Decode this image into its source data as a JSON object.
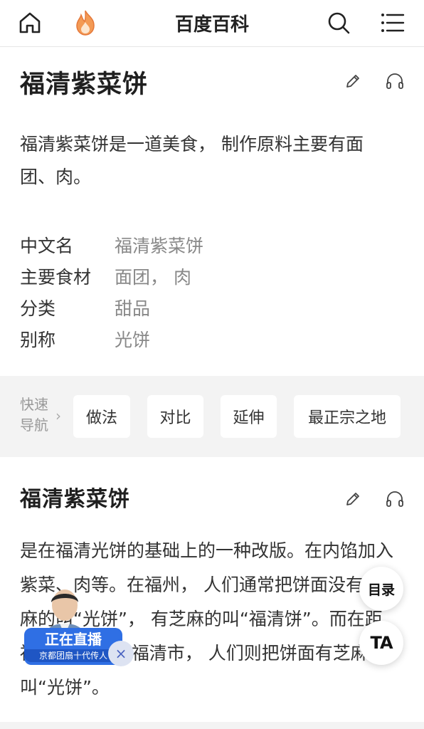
{
  "header": {
    "brand": "百度百科",
    "icons": [
      "home-icon",
      "flame-icon",
      "search-icon",
      "menu-icon"
    ]
  },
  "entry": {
    "title": "福清紫菜饼",
    "summary": "福清紫菜饼是一道美食， 制作原料主要有面团、肉。",
    "info": [
      {
        "key": "中文名",
        "value": "福清紫菜饼"
      },
      {
        "key": "主要食材",
        "value": "面团， 肉"
      },
      {
        "key": "分类",
        "value": "甜品"
      },
      {
        "key": "别称",
        "value": "光饼"
      }
    ]
  },
  "quick_nav": {
    "label": "快速导航",
    "arrow": "›",
    "items": [
      "做法",
      "对比",
      "延伸",
      "最正宗之地"
    ]
  },
  "section": {
    "title": "福清紫菜饼",
    "paragraph": "是在福清光饼的基础上的一种改版。在内馅加入紫菜、肉等。在福州， 人们通常把饼面没有芝麻的叫“光饼”， 有芝麻的叫“福清饼”。而在距福州60公里的福清市， 人们则把饼面有芝麻的叫“光饼”。"
  },
  "live_widget": {
    "status": "正在直播",
    "subtitle": "京都团扇十代传人",
    "close": "×"
  },
  "floating": {
    "toc": "目录",
    "ta": "TA"
  },
  "colors": {
    "accent": "#2f6fe4",
    "flame": "#f08a3c",
    "nav_bg": "#f3f3f3"
  }
}
